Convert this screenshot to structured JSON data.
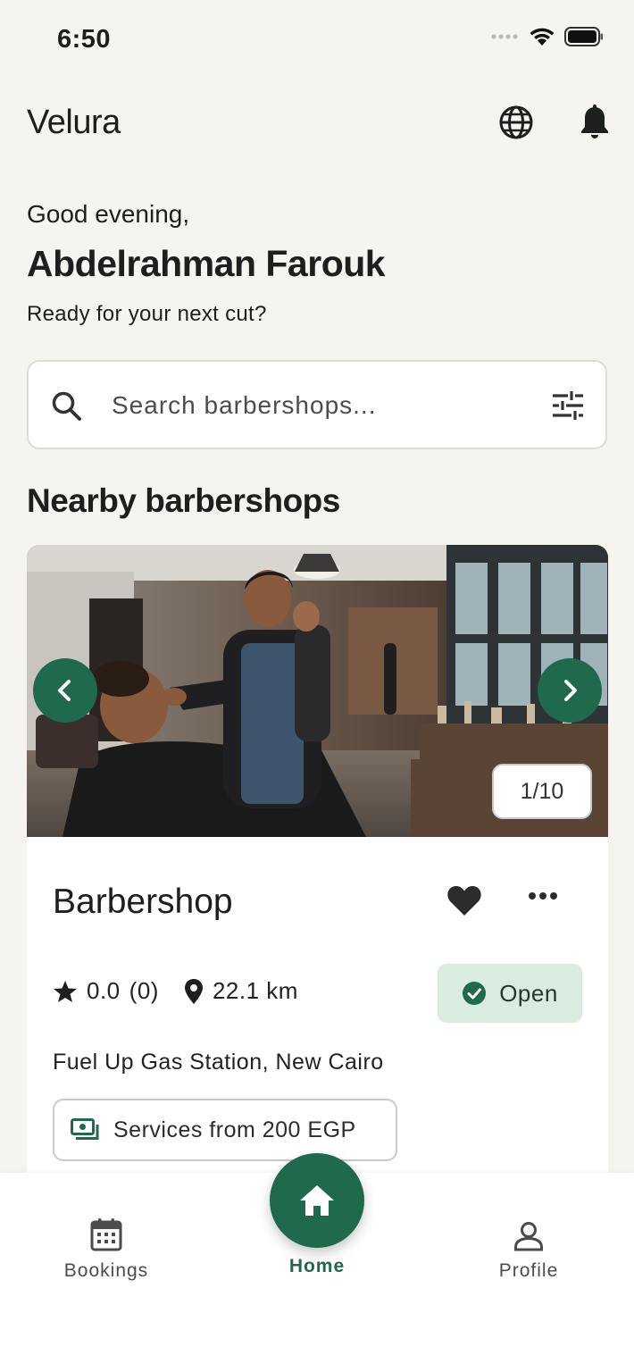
{
  "status_bar": {
    "time": "6:50"
  },
  "header": {
    "app_name": "Velura"
  },
  "greeting": {
    "salutation": "Good evening,",
    "user_name": "Abdelrahman Farouk",
    "tagline": "Ready for your next cut?"
  },
  "search": {
    "placeholder": "Search barbershops..."
  },
  "section": {
    "title": "Nearby barbershops"
  },
  "card": {
    "image_counter": "1/10",
    "name": "Barbershop",
    "rating": "0.0",
    "reviews": "(0)",
    "distance": "22.1 km",
    "status": "Open",
    "address": "Fuel Up Gas Station, New Cairo",
    "price_label": "Services from 200 EGP"
  },
  "bottom_nav": {
    "bookings": "Bookings",
    "home": "Home",
    "profile": "Profile"
  },
  "colors": {
    "accent": "#1f6a4c",
    "open_badge_bg": "#d9ecdf",
    "background": "#f6f4ee"
  },
  "icons": [
    "signal-icon",
    "wifi-icon",
    "battery-icon",
    "globe-icon",
    "bell-icon",
    "search-icon",
    "filter-icon",
    "chevron-left-icon",
    "chevron-right-icon",
    "heart-icon",
    "more-icon",
    "star-icon",
    "location-pin-icon",
    "check-circle-icon",
    "money-icon",
    "calendar-icon",
    "home-icon",
    "person-icon"
  ]
}
